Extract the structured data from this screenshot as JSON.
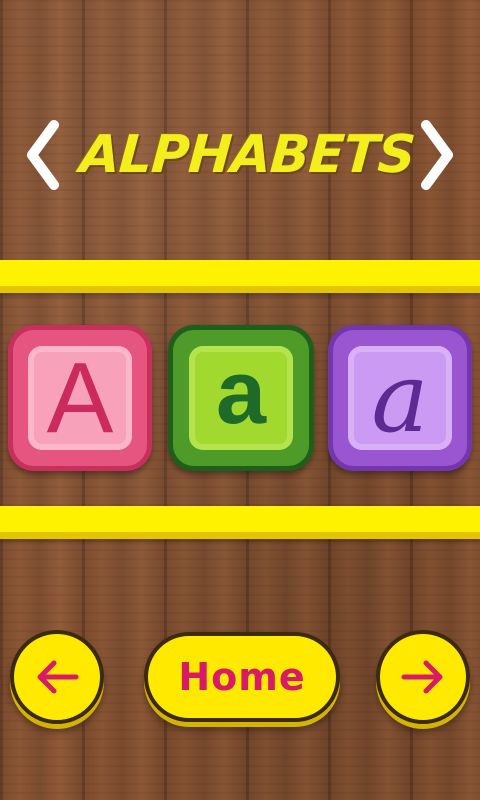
{
  "header": {
    "title": "ALPHABETS"
  },
  "tiles": [
    {
      "letter": "A",
      "style": "uppercase",
      "color": "#e6557f"
    },
    {
      "letter": "a",
      "style": "lowercase",
      "color": "#4f9b2a"
    },
    {
      "letter": "a",
      "style": "cursive",
      "color": "#9a55d0"
    }
  ],
  "footer": {
    "home_label": "Home"
  },
  "colors": {
    "accent_yellow": "#fff200",
    "title_yellow": "#f4ee1f",
    "arrow_pink": "#d81b66",
    "wood": "#7a4a2e"
  },
  "icons": {
    "header_left": "chevron-left-icon",
    "header_right": "chevron-right-icon",
    "footer_left": "arrow-left-icon",
    "footer_right": "arrow-right-icon"
  }
}
